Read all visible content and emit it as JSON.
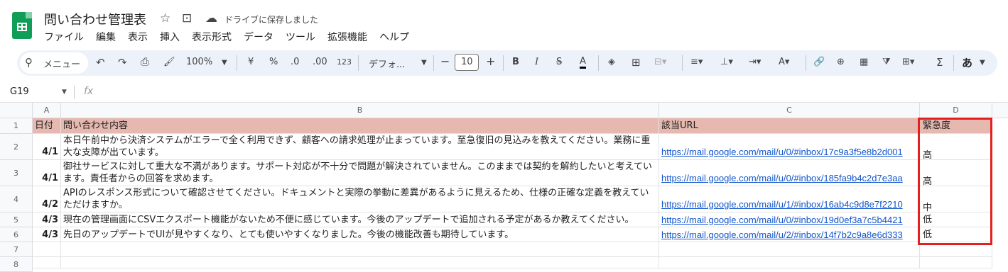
{
  "app": {
    "title": "問い合わせ管理表",
    "saved_status": "ドライブに保存しました",
    "brand_color": "#0f9d58"
  },
  "menu": [
    "ファイル",
    "編集",
    "表示",
    "挿入",
    "表示形式",
    "データ",
    "ツール",
    "拡張機能",
    "ヘルプ"
  ],
  "toolbar": {
    "search_label": "メニュー",
    "zoom": "100%",
    "currency": "¥",
    "percent": "%",
    "dec_decrease": ".0",
    "dec_increase": ".00",
    "number_format": "123",
    "font": "デフォ...",
    "font_size": "10",
    "input_mode": "あ"
  },
  "formula_bar": {
    "cell_ref": "G19",
    "fx": "fx",
    "value": ""
  },
  "columns": [
    "A",
    "B",
    "C",
    "D"
  ],
  "rows": [
    "1",
    "2",
    "3",
    "4",
    "5",
    "6",
    "7",
    "8"
  ],
  "sheet": {
    "header": {
      "date": "日付",
      "content": "問い合わせ内容",
      "url": "該当URL",
      "urgency": "緊急度"
    },
    "rows": [
      {
        "date": "4/1",
        "content": "本日午前中から決済システムがエラーで全く利用できず、顧客への請求処理が止まっています。至急復旧の見込みを教えてください。業務に重大な支障が出ています。",
        "url": "https://mail.google.com/mail/u/0/#inbox/17c9a3f5e8b2d001",
        "urgency": "高"
      },
      {
        "date": "4/1",
        "content": "御社サービスに対して重大な不満があります。サポート対応が不十分で問題が解決されていません。このままでは契約を解約したいと考えています。責任者からの回答を求めます。",
        "url": "https://mail.google.com/mail/u/0/#inbox/185fa9b4c2d7e3aa",
        "urgency": "高"
      },
      {
        "date": "4/2",
        "content": "APIのレスポンス形式について確認させてください。ドキュメントと実際の挙動に差異があるように見えるため、仕様の正確な定義を教えていただけますか。",
        "url": "https://mail.google.com/mail/u/1/#inbox/16ab4c9d8e7f2210",
        "urgency": "中"
      },
      {
        "date": "4/3",
        "content": "現在の管理画面にCSVエクスポート機能がないため不便に感じています。今後のアップデートで追加される予定があるか教えてください。",
        "url": "https://mail.google.com/mail/u/0/#inbox/19d0ef3a7c5b4421",
        "urgency": "低"
      },
      {
        "date": "4/3",
        "content": "先日のアップデートでUIが見やすくなり、とても使いやすくなりました。今後の機能改善も期待しています。",
        "url": "https://mail.google.com/mail/u/2/#inbox/14f7b2c9a8e6d333",
        "urgency": "低"
      }
    ]
  },
  "colors": {
    "header_fill": "#e6b8af",
    "highlight_border": "#e51f1f",
    "link": "#1155cc"
  }
}
